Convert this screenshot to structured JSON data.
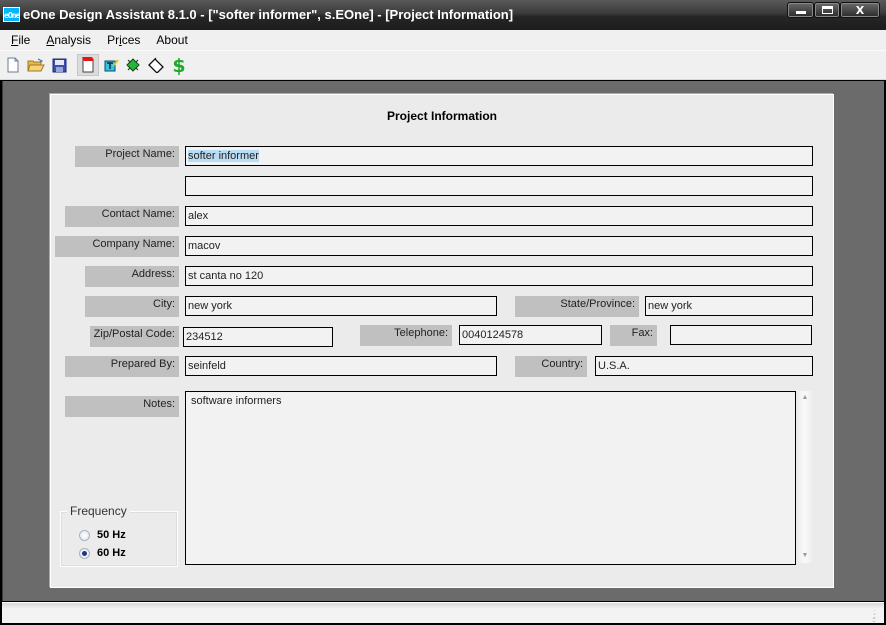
{
  "window": {
    "app_icon_text": "eOne",
    "title": "eOne Design Assistant 8.1.0 - [\"softer informer\", s.EOne] - [Project Information]",
    "controls": {
      "minimize": "minimize",
      "maximize": "maximize",
      "close": "X"
    }
  },
  "menu": [
    {
      "label": "File",
      "mnemonic": "F"
    },
    {
      "label": "Analysis",
      "mnemonic": "A"
    },
    {
      "label": "Prices",
      "mnemonic": "i"
    },
    {
      "label": "About",
      "mnemonic": ""
    }
  ],
  "menu_labels": {
    "file_pre": "",
    "file_key": "F",
    "file_post": "ile",
    "analysis_pre": "",
    "analysis_key": "A",
    "analysis_post": "nalysis",
    "prices_pre": "Pr",
    "prices_key": "i",
    "prices_post": "ces",
    "about": "About"
  },
  "toolbar": {
    "buttons": [
      "new-document-icon",
      "open-folder-icon",
      "save-icon",
      "project-info-icon",
      "edit-sheet-icon",
      "component-icon",
      "tag-icon",
      "dollar-icon"
    ],
    "active": "project-info-icon"
  },
  "form": {
    "title": "Project Information",
    "fields": {
      "project_name": {
        "label": "Project Name:",
        "value": "softer informer"
      },
      "project_name_2": {
        "value": ""
      },
      "contact_name": {
        "label": "Contact Name:",
        "value": "alex"
      },
      "company_name": {
        "label": "Company Name:",
        "value": "macov"
      },
      "address": {
        "label": "Address:",
        "value": "st canta no 120"
      },
      "city": {
        "label": "City:",
        "value": "new york"
      },
      "state": {
        "label": "State/Province:",
        "value": "new york"
      },
      "zip": {
        "label": "Zip/Postal Code:",
        "value": "234512"
      },
      "telephone": {
        "label": "Telephone:",
        "value": "0040124578"
      },
      "fax": {
        "label": "Fax:",
        "value": ""
      },
      "prepared_by": {
        "label": "Prepared By:",
        "value": "seinfeld"
      },
      "country": {
        "label": "Country:",
        "value": "U.S.A."
      },
      "notes": {
        "label": "Notes:",
        "value": "software informers"
      }
    },
    "frequency": {
      "legend": "Frequency",
      "options": [
        {
          "label": "50 Hz",
          "selected": false
        },
        {
          "label": "60 Hz",
          "selected": true
        }
      ]
    }
  },
  "colors": {
    "selection_highlight": "#b9dcf5",
    "mdi_background": "#6b6b6b",
    "label_background": "#c0c0c0",
    "dollar_green": "#1ea82c"
  }
}
